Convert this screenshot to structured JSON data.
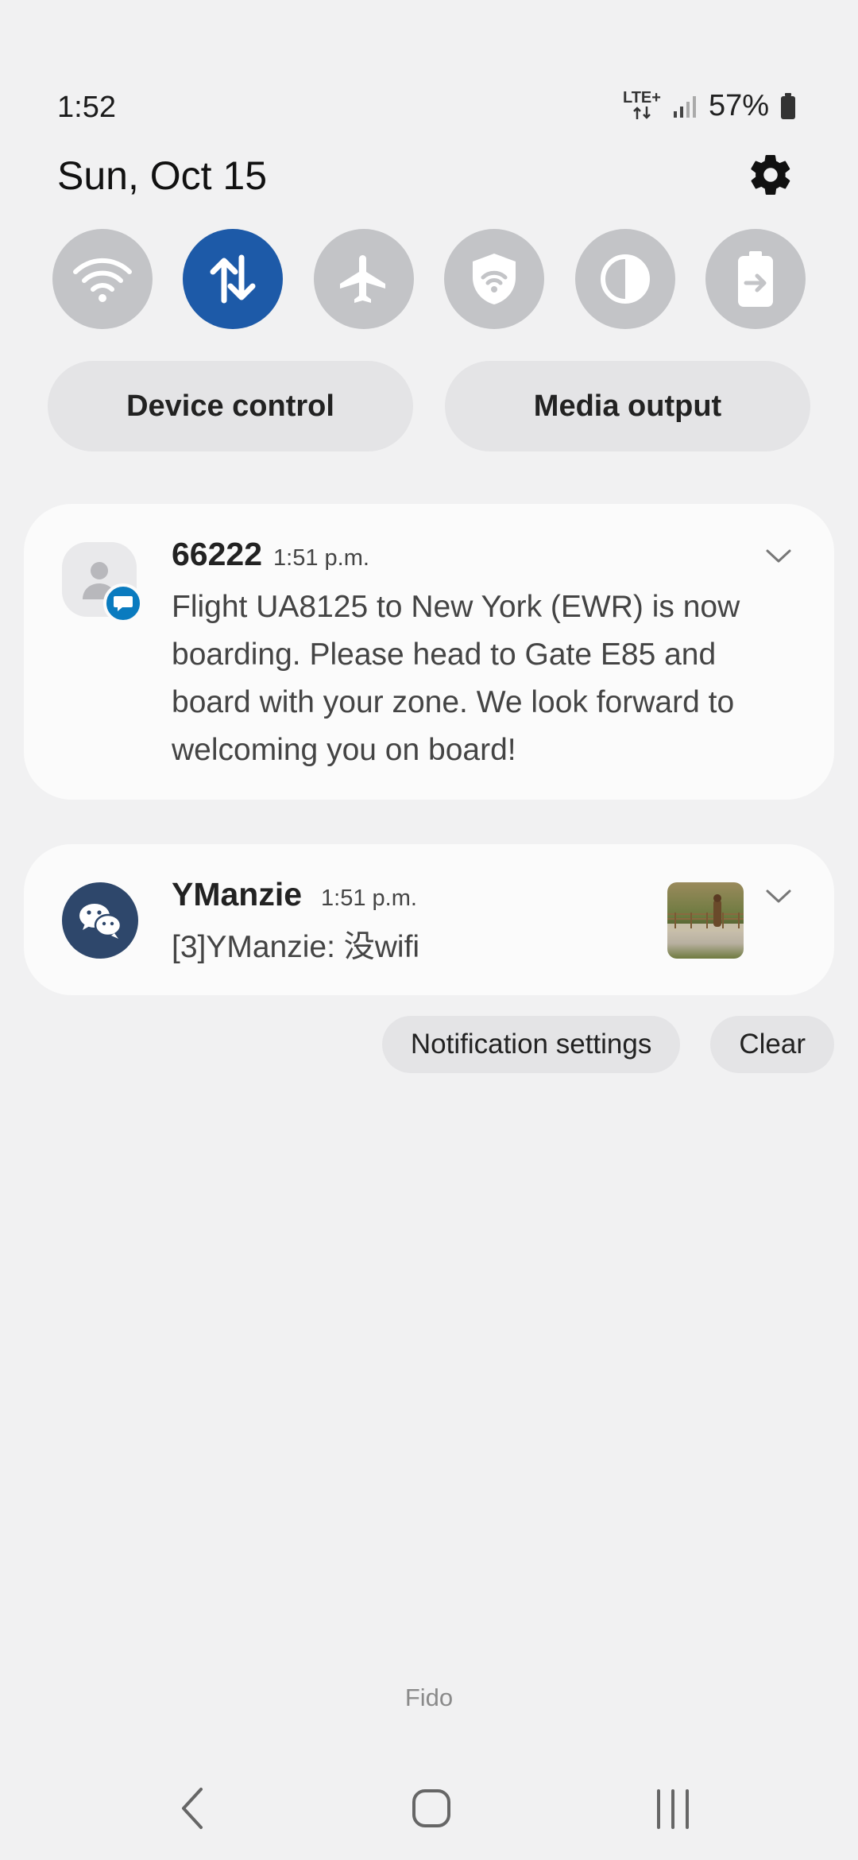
{
  "status_bar": {
    "time": "1:52",
    "network_top": "LTE+",
    "battery": "57%"
  },
  "header": {
    "date": "Sun, Oct 15"
  },
  "quick_settings": {
    "tiles": [
      {
        "icon": "wifi-icon",
        "active": false
      },
      {
        "icon": "mobile-data-icon",
        "active": true
      },
      {
        "icon": "airplane-icon",
        "active": false
      },
      {
        "icon": "secure-wifi-icon",
        "active": false
      },
      {
        "icon": "contrast-icon",
        "active": false
      },
      {
        "icon": "power-share-icon",
        "active": false
      }
    ],
    "device_control_label": "Device control",
    "media_output_label": "Media output"
  },
  "notifications": [
    {
      "app": "Messages",
      "title": "66222",
      "time": "1:51 p.m.",
      "body": "Flight UA8125 to New York (EWR) is now boarding. Please head to Gate E85 and board with your zone. We look forward to welcoming you on board!"
    },
    {
      "app": "WeChat",
      "title": "YManzie",
      "time": "1:51 p.m.",
      "body": "[3]YManzie: 没wifi"
    }
  ],
  "actions": {
    "notification_settings_label": "Notification settings",
    "clear_label": "Clear"
  },
  "carrier": "Fido",
  "colors": {
    "accent": "#1d5aa8",
    "tile_inactive": "#c3c4c7",
    "badge": "#0a7bbf",
    "wechat": "#2e476b"
  }
}
